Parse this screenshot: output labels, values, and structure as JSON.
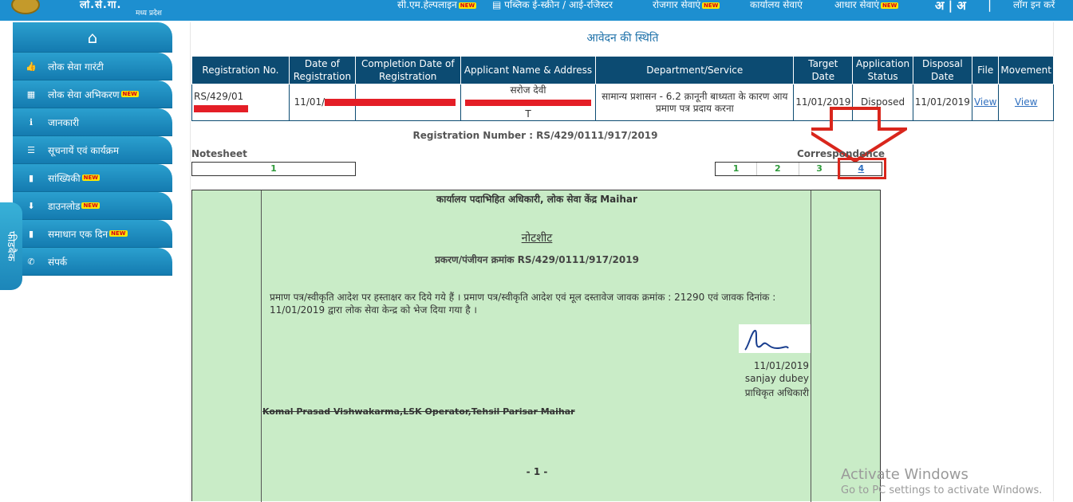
{
  "header": {
    "logo_text": "लो.से.गा.",
    "logo_subtitle": "मध्य प्रदेश",
    "nav": [
      {
        "label": "सी.एम.हेल्पलाइन",
        "new": true
      },
      {
        "label": "पब्लिक ई-स्क्रीन / आई-रजिस्टर",
        "new": false
      },
      {
        "label": "रोजगार सेवाएं",
        "new": true
      },
      {
        "label": "कार्यालय सेवाएं",
        "new": false
      },
      {
        "label": "आधार सेवाएं",
        "new": true
      },
      {
        "label": "अ | अ",
        "new": false
      },
      {
        "label": "|",
        "new": false
      },
      {
        "label": "लॉग इन करें",
        "new": false
      }
    ],
    "new_badge": "NEW"
  },
  "sidebar": {
    "home_icon": "home-icon",
    "items": [
      {
        "label": "लोक सेवा गारंटी",
        "icon": "thumbs-up-icon",
        "glyph": "👍",
        "new": false
      },
      {
        "label": "लोक सेवा अभिकरण",
        "icon": "grid-icon",
        "glyph": "▦",
        "new": true
      },
      {
        "label": "जानकारी",
        "icon": "info-icon",
        "glyph": "ℹ",
        "new": false
      },
      {
        "label": "सूचनायें एवं कार्यक्रम",
        "icon": "list-icon",
        "glyph": "☰",
        "new": false
      },
      {
        "label": "सांख्यिकी",
        "icon": "bar-chart-icon",
        "glyph": "▮",
        "new": true
      },
      {
        "label": "डाउनलोड",
        "icon": "download-icon",
        "glyph": "⬇",
        "new": true
      },
      {
        "label": "समाधान एक दिन",
        "icon": "bar-chart-icon",
        "glyph": "▮",
        "new": true
      },
      {
        "label": "संपर्क",
        "icon": "phone-icon",
        "glyph": "✆",
        "new": false
      }
    ],
    "floating_tab": "फीडबैक"
  },
  "main": {
    "title": "आवेदन की स्थिति",
    "table": {
      "headers": [
        "Registration No.",
        "Date of Registration",
        "Completion Date of Registration",
        "Applicant Name & Address",
        "Department/Service",
        "Target Date",
        "Application Status",
        "Disposal Date",
        "File",
        "Movement"
      ],
      "row": {
        "registration_no": "RS/429/01",
        "date_of_registration": "11/01/",
        "applicant_name": "सरोज देवी",
        "applicant_address_tail": "T",
        "department_service": "सामान्य प्रशासन - 6.2 क़ानूनी बाध्यता के कारण आय प्रमाण पत्र प्रदाय करना",
        "target_date": "11/01/2019",
        "application_status": "Disposed",
        "disposal_date": "11/01/2019",
        "file_link": "View",
        "movement_link": "View"
      }
    },
    "registration_number": "Registration Number : RS/429/0111/917/2019",
    "notesheet_label": "Notesheet",
    "correspondence_label": "Correspondence",
    "notesheet_pages": [
      "1"
    ],
    "correspondence_pages": [
      "1",
      "2",
      "3",
      "4"
    ],
    "document": {
      "office": "कार्यालय पदाभिहित अधिकारी, लोक सेवा केंद्र Maihar",
      "heading": "नोटशीट",
      "case_number": "प्रकरण/पंजीयन क्रमांक RS/429/0111/917/2019",
      "body": "प्रमाण पत्र/स्वीकृति आदेश पर हस्ताक्षर कर दिये गये हैं । प्रमाण पत्र/स्वीकृति आदेश एवं मूल दस्तावेज जावक क्रमांक : 21290 एवं जावक दिनांक : 11/01/2019 द्वारा लोक सेवा केन्द्र को भेज दिया गया है ।",
      "date": "11/01/2019",
      "signer": "sanjay dubey",
      "signer_role": "प्राधिकृत अधिकारी",
      "operator": "Komal Prasad Vishwakarma,LSK Operator,Tehsil Parisar Maihar",
      "page_marker": "- 1 -"
    }
  },
  "watermark": {
    "title": "Activate Windows",
    "subtitle": "Go to PC settings to activate Windows."
  },
  "colors": {
    "top_bar": "#1d8fd0",
    "sidebar": "#147bb0",
    "table_header": "#0c4b72",
    "document_bg": "#c9ecc7",
    "annotation_red": "#d9261c",
    "redaction": "#e41e26"
  }
}
